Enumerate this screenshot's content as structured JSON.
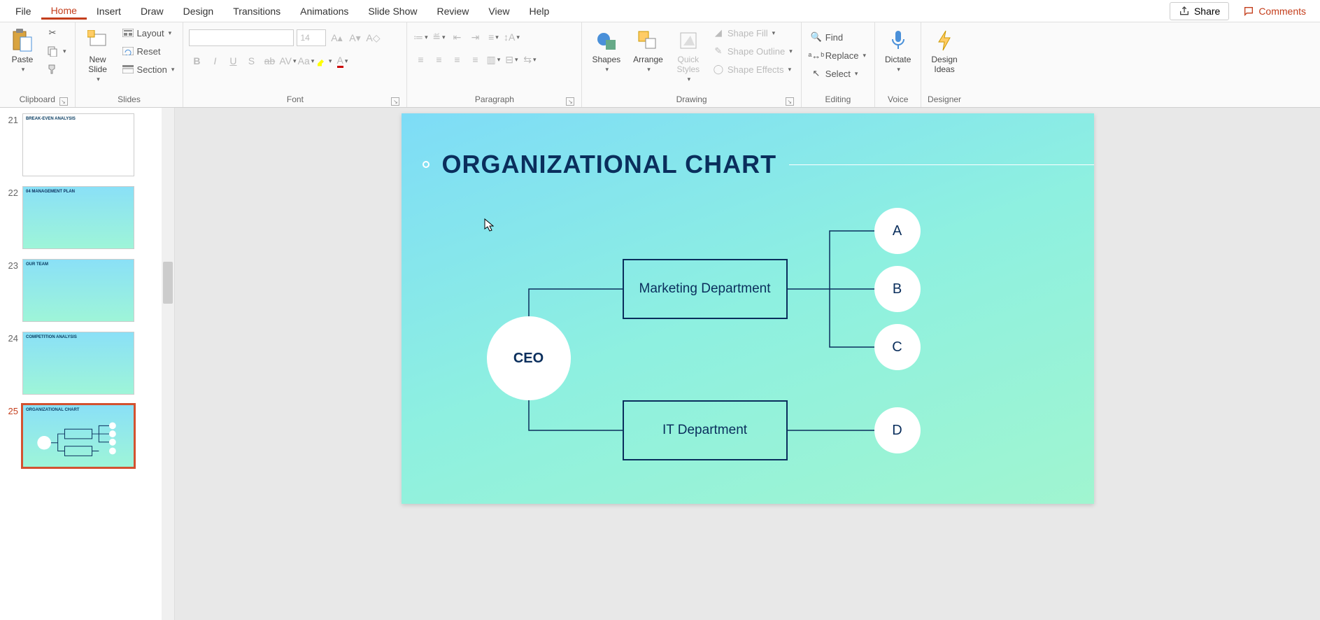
{
  "menubar": {
    "items": [
      "File",
      "Home",
      "Insert",
      "Draw",
      "Design",
      "Transitions",
      "Animations",
      "Slide Show",
      "Review",
      "View",
      "Help"
    ],
    "active": "Home",
    "share": "Share",
    "comments": "Comments"
  },
  "ribbon": {
    "clipboard": {
      "label": "Clipboard",
      "paste": "Paste"
    },
    "slides": {
      "label": "Slides",
      "new_slide": "New\nSlide",
      "layout": "Layout",
      "reset": "Reset",
      "section": "Section"
    },
    "font": {
      "label": "Font",
      "size": "14"
    },
    "paragraph": {
      "label": "Paragraph"
    },
    "drawing": {
      "label": "Drawing",
      "shapes": "Shapes",
      "arrange": "Arrange",
      "quick_styles": "Quick\nStyles",
      "shape_fill": "Shape Fill",
      "shape_outline": "Shape Outline",
      "shape_effects": "Shape Effects"
    },
    "editing": {
      "label": "Editing",
      "find": "Find",
      "replace": "Replace",
      "select": "Select"
    },
    "voice": {
      "label": "Voice",
      "dictate": "Dictate"
    },
    "designer": {
      "label": "Designer",
      "design_ideas": "Design\nIdeas"
    }
  },
  "thumbnails": [
    {
      "num": "21",
      "title": "BREAK-EVEN ANALYSIS"
    },
    {
      "num": "22",
      "title": "04 MANAGEMENT PLAN"
    },
    {
      "num": "23",
      "title": "OUR TEAM"
    },
    {
      "num": "24",
      "title": "COMPETITION ANALYSIS"
    },
    {
      "num": "25",
      "title": "ORGANIZATIONAL CHART",
      "selected": true
    }
  ],
  "slide": {
    "title": "ORGANIZATIONAL CHART",
    "ceo": "CEO",
    "marketing": "Marketing Department",
    "it": "IT Department",
    "a": "A",
    "b": "B",
    "c": "C",
    "d": "D"
  },
  "colors": {
    "accent": "#c43e1c",
    "org_stroke": "#0a2e5c"
  }
}
